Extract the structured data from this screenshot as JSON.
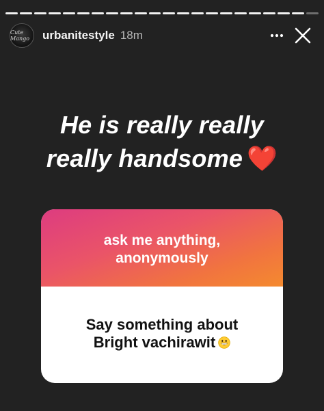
{
  "story": {
    "progress": {
      "segments": 22,
      "completed": 21
    },
    "header": {
      "username": "urbanitestyle",
      "time": "18m",
      "avatar_text": "Cute Mango",
      "more_icon": "more-dots-icon",
      "close_icon": "close-icon"
    },
    "caption": {
      "line1": "He is really really",
      "line2": "really handsome",
      "emoji": "❤️"
    },
    "question_sticker": {
      "prompt_line1": "ask me anything,",
      "prompt_line2": "anonymously",
      "answer_line1": "Say something about",
      "answer_line2": "Bright vachirawit",
      "answer_emoji": "grinning-face-emoji"
    }
  },
  "colors": {
    "background": "#222222",
    "gradient_start": "#dd3c80",
    "gradient_end": "#f48a2f",
    "heart": "#e0142b"
  }
}
